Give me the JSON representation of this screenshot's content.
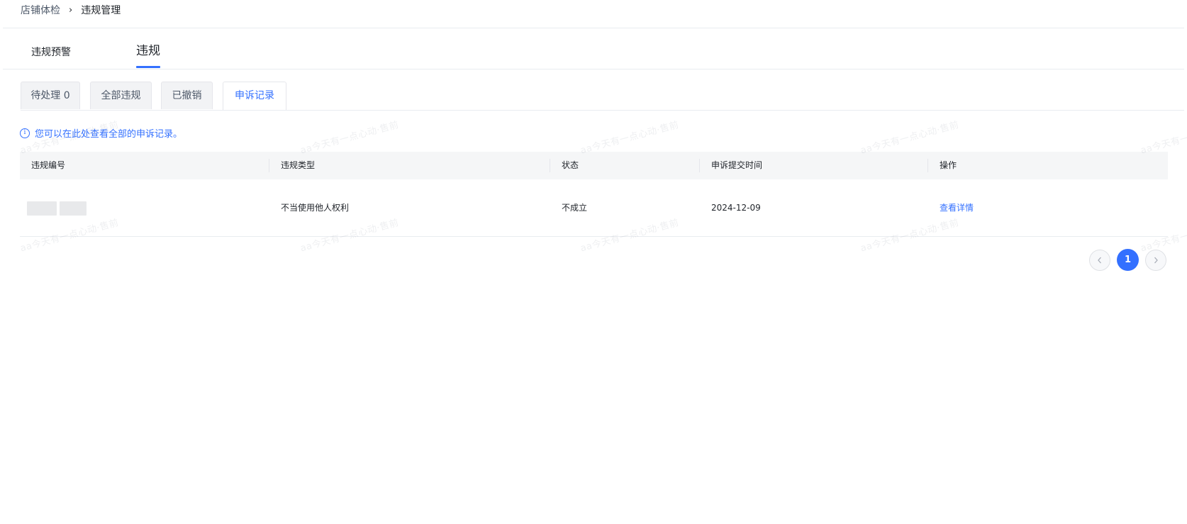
{
  "breadcrumb": {
    "parent": "店铺体检",
    "separator": "›",
    "current": "违规管理"
  },
  "main_tabs": [
    {
      "label": "违规预警",
      "active": false
    },
    {
      "label": "违规",
      "active": true
    }
  ],
  "sub_tabs": [
    {
      "label": "待处理 0",
      "active": false
    },
    {
      "label": "全部违规",
      "active": false
    },
    {
      "label": "已撤销",
      "active": false
    },
    {
      "label": "申诉记录",
      "active": true
    }
  ],
  "info": {
    "icon": "info-icon",
    "text": "您可以在此处查看全部的申诉记录。"
  },
  "table": {
    "columns": [
      "违规编号",
      "违规类型",
      "状态",
      "申诉提交时间",
      "操作"
    ],
    "rows": [
      {
        "id": "",
        "type": "不当使用他人权利",
        "status": "不成立",
        "submit_time": "2024-12-09",
        "action": "查看详情"
      }
    ]
  },
  "pagination": {
    "current_page": "1",
    "prev_icon": "chevron-left-icon",
    "next_icon": "chevron-right-icon"
  },
  "watermark": "aa今天有一点心动·售前",
  "colors": {
    "accent": "#3370ff",
    "header_bg": "#f5f6f7",
    "tab_bg": "#f2f3f5"
  }
}
